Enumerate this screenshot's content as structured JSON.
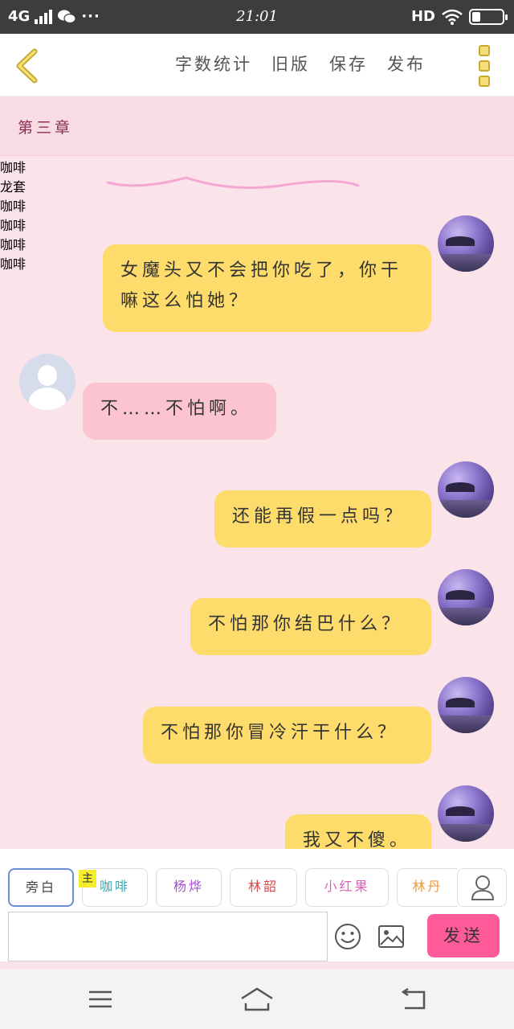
{
  "status_bar": {
    "network": "4G",
    "time": "21:01",
    "hd": "HD"
  },
  "toolbar": {
    "word_count": "字数统计",
    "old_version": "旧版",
    "save": "保存",
    "publish": "发布"
  },
  "chapter": {
    "title": "第三章"
  },
  "messages": [
    {
      "side": "right",
      "name": "咖啡",
      "text": "女魔头又不会把你吃了，你干嘛这么怕她？"
    },
    {
      "side": "left",
      "name": "龙套",
      "text": "不……不怕啊。"
    },
    {
      "side": "right",
      "name": "咖啡",
      "text": "还能再假一点吗？"
    },
    {
      "side": "right",
      "name": "咖啡",
      "text": "不怕那你结巴什么？"
    },
    {
      "side": "right",
      "name": "咖啡",
      "text": "不怕那你冒冷汗干什么？"
    },
    {
      "side": "right",
      "name": "咖啡",
      "text": "我又不傻。"
    }
  ],
  "roles": {
    "narration": "旁白",
    "master_badge": "主",
    "items": [
      {
        "label": "咖啡",
        "color": "#36a9b8"
      },
      {
        "label": "杨烨",
        "color": "#a14fd0"
      },
      {
        "label": "林韶",
        "color": "#d94848"
      },
      {
        "label": "小红果",
        "color": "#e060b8"
      },
      {
        "label": "林丹",
        "color": "#ee9a3e"
      }
    ]
  },
  "composer": {
    "send": "发送",
    "input_value": ""
  },
  "colors": {
    "background": "#fbe3ea",
    "bubble_self": "#fedc6c",
    "bubble_other": "#fcc4d1",
    "send_button": "#ff5a9a",
    "name_color": "#8a2e57"
  }
}
